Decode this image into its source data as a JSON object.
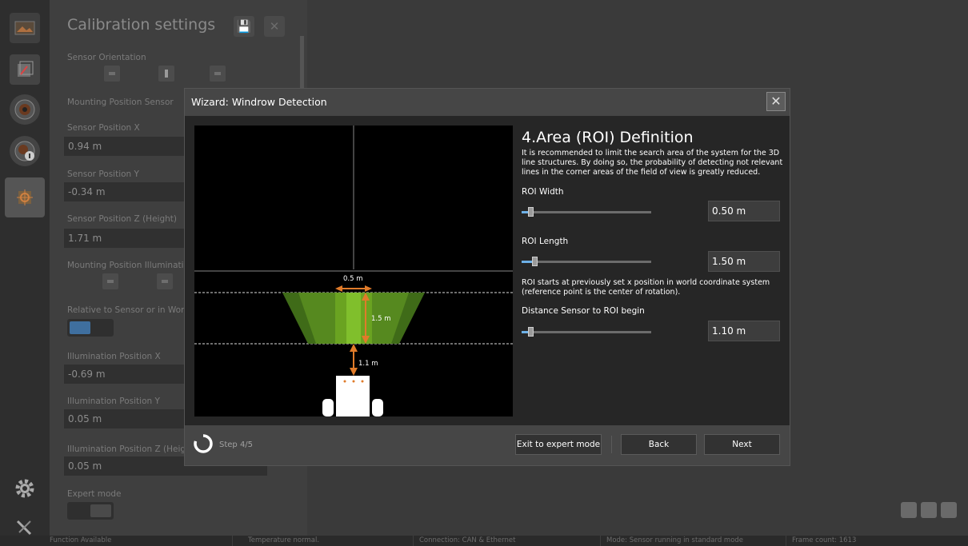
{
  "panel": {
    "title": "Calibration settings",
    "sensor_orientation_label": "Sensor Orientation",
    "mounting_position_sensor_label": "Mounting Position Sensor",
    "sensor_position_x_label": "Sensor Position X",
    "sensor_position_x_value": "0.94 m",
    "sensor_position_y_label": "Sensor Position Y",
    "sensor_position_y_value": "-0.34 m",
    "sensor_position_z_label": "Sensor Position Z (Height)",
    "sensor_position_z_value": "1.71 m",
    "mounting_position_illumination_label": "Mounting Position Illumination",
    "relative_label": "Relative to Sensor or in World",
    "illumination_x_label": "Illumination Position X",
    "illumination_x_value": "-0.69 m",
    "illumination_y_label": "Illumination Position Y",
    "illumination_y_value": "0.05 m",
    "illumination_z_label": "Illumination Position Z (Height)",
    "illumination_z_value": "0.05 m",
    "expert_mode_label": "Expert mode"
  },
  "status_bar": {
    "function": "Function Available",
    "temperature": "Temperature normal.",
    "connection": "Connection: CAN & Ethernet",
    "mode": "Mode: Sensor running in standard mode",
    "frame_count": "Frame count: 1613"
  },
  "wizard": {
    "title": "Wizard: Windrow Detection",
    "heading": "4.Area (ROI) Definition",
    "description": "It is recommended to limit the search area of the system for the 3D line structures. By doing so, the probability of detecting not relevant lines in the corner areas of the field of view is greatly reduced.",
    "roi_width_label": "ROI Width",
    "roi_width_value": "0.50 m",
    "roi_width_fraction": 0.07,
    "roi_length_label": "ROI Length",
    "roi_length_value": "1.50 m",
    "roi_length_fraction": 0.1,
    "note": "ROI starts at previously set x position in world coordinate system (reference point is the center of rotation).",
    "distance_label": "Distance Sensor to ROI begin",
    "distance_value": "1.10 m",
    "distance_fraction": 0.07,
    "diagram": {
      "width_label": "0.5 m",
      "length_label": "1.5 m",
      "distance_label": "1.1 m"
    },
    "step": "Step 4/5",
    "exit_button": "Exit to expert mode",
    "back_button": "Back",
    "next_button": "Next"
  },
  "colors": {
    "accent_blue": "#6db0e6",
    "roi_green": "#6aa321",
    "arrow_orange": "#e07b2a"
  }
}
